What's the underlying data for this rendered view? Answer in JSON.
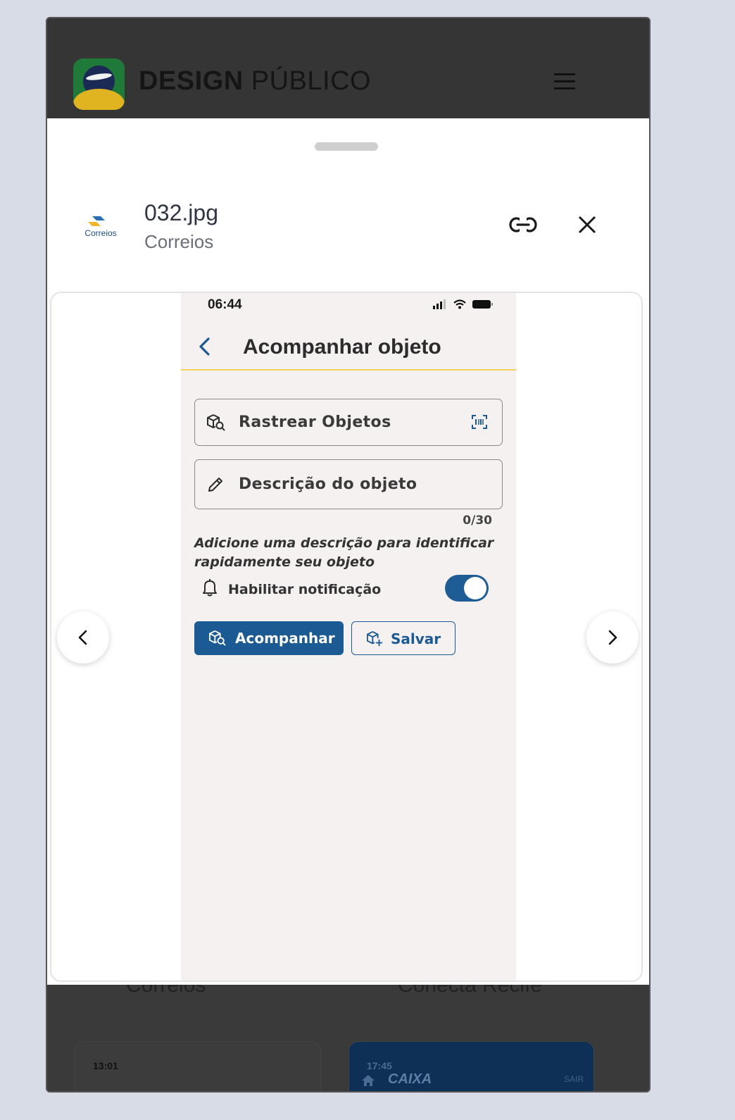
{
  "site": {
    "title_bold": "DESIGN",
    "title_light": "PÚBLICO",
    "logo_icon": "brazil-globe-logo",
    "menu_icon": "hamburger-icon"
  },
  "background": {
    "labels": [
      "Correios",
      "Conecta Recife"
    ],
    "cards": [
      {
        "time": "13:01"
      },
      {
        "time": "17:45",
        "brand": "CAIXA",
        "action": "SAIR"
      }
    ]
  },
  "sheet": {
    "file_name": "032.jpg",
    "app_name": "Correios",
    "brand_logo_text": "Correios",
    "link_icon": "link-icon",
    "close_icon": "close-icon",
    "prev_icon": "chevron-left-icon",
    "next_icon": "chevron-right-icon"
  },
  "phone": {
    "status_time": "06:44",
    "title": "Acompanhar objeto",
    "field_track_label": "Rastrear Objetos",
    "field_desc_label": "Descrição do objeto",
    "counter": "0/30",
    "hint": "Adicione uma descrição para identificar rapidamente seu objeto",
    "notification_label": "Habilitar notificação",
    "notification_enabled": true,
    "btn_track": "Acompanhar",
    "btn_save": "Salvar"
  },
  "colors": {
    "primary": "#1b5a92",
    "accent_line": "#f3d35a",
    "header_bg": "#353535",
    "phone_bg": "#f4f1f0"
  }
}
